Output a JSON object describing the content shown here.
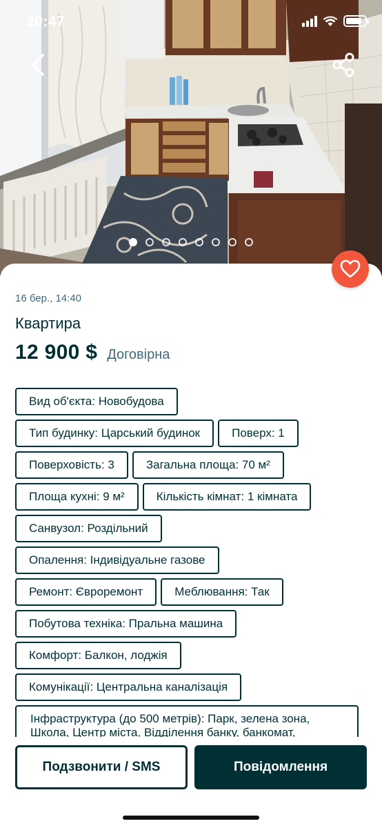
{
  "status_bar": {
    "time": "20:47",
    "icons": [
      "cellular-signal-icon",
      "wifi-icon",
      "battery-icon"
    ],
    "battery_level": 0.85
  },
  "gallery": {
    "photo_subject": "kitchen",
    "photo_count": 8,
    "active_index": 0,
    "back_icon": "chevron-left-icon",
    "share_icon": "share-icon"
  },
  "listing": {
    "date": "16 бер., 14:40",
    "title": "Квартира",
    "price": "12 900 $",
    "price_note": "Договірна",
    "favorite_icon": "heart-icon"
  },
  "tags": [
    [
      "Вид об'єкта: Новобудова"
    ],
    [
      "Тип будинку: Царський будинок",
      "Поверх: 1"
    ],
    [
      "Поверховість: 3",
      "Загальна площа: 70 м²"
    ],
    [
      "Площа кухні: 9 м²",
      "Кількість кімнат: 1 кімната"
    ],
    [
      "Санвузол: Роздільний"
    ],
    [
      "Опалення: Індивідуальне газове"
    ],
    [
      "Ремонт: Євроремонт",
      "Меблювання: Так"
    ],
    [
      "Побутова техніка: Пральна машина"
    ],
    [
      "Комфорт: Балкон, лоджія"
    ],
    [
      "Комунікації: Центральна каналізація"
    ]
  ],
  "infrastructure_tag": "Інфраструктура (до 500 метрів): Парк, зелена зона, Школа, Центр міста, Відділення банку, банкомат,",
  "actions": {
    "call_label": "Подзвонити / SMS",
    "message_label": "Повідомлення"
  },
  "colors": {
    "primary": "#002f34",
    "accent_favorite": "#f2573e",
    "muted_text": "#3e6a7a"
  }
}
